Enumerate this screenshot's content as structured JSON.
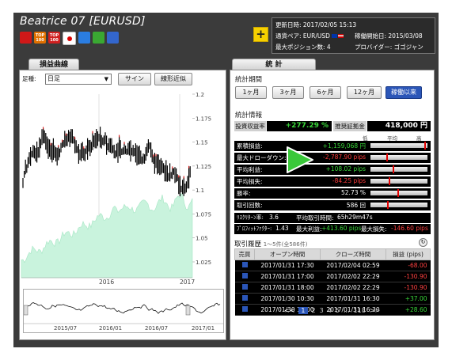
{
  "header": {
    "title": "Beatrice 07 [EURUSD]",
    "icons": [
      {
        "name": "ranking-icon",
        "text": "",
        "color": "#d01818"
      },
      {
        "name": "top100-icon",
        "text": "TOP 100",
        "color": "#e07000"
      },
      {
        "name": "top100-alt-icon",
        "text": "TOP 100",
        "color": "#d02020"
      },
      {
        "name": "japan-flag-icon",
        "text": "",
        "color": "#ffffff"
      },
      {
        "name": "chart-badge-icon",
        "text": "",
        "color": "#2a7de1"
      },
      {
        "name": "trophy-icon",
        "text": "",
        "color": "#3aa832"
      },
      {
        "name": "globe-icon",
        "text": "",
        "color": "#3366cc"
      }
    ],
    "add_button": "+"
  },
  "info": {
    "updated": "更新日時: 2017/02/05 15:13",
    "pair": "通貨ペア: EUR/USD",
    "start": "稼働開始日: 2015/03/08",
    "max_positions": "最大ポジション数: 4",
    "provider": "プロバイダー: ゴゴジャン"
  },
  "left": {
    "tab": "損益曲線",
    "foot_label": "足種:",
    "foot_value": "日足",
    "sign_button": "サイン",
    "linear_button": "線形近似",
    "yticks": [
      "1.2",
      "1.175",
      "1.15",
      "1.125",
      "1.1",
      "1.075",
      "1.05",
      "1.025"
    ],
    "xticks": [
      "2016",
      "2017"
    ],
    "nav_xticks": [
      "2015/07",
      "2016/01",
      "2016/07",
      "2017/01"
    ]
  },
  "right": {
    "tab": "統 計",
    "period_title": "統計期間",
    "periods": [
      "1ヶ月",
      "3ヶ月",
      "6ヶ月",
      "12ヶ月",
      "稼働以来"
    ],
    "stats_title": "統計情報",
    "roi_label": "投資収益率",
    "roi_value": "+277.29 %",
    "margin_label": "推奨証拠金",
    "margin_value": "418,000 円",
    "scale": [
      "低",
      "平均",
      "高"
    ],
    "rows": [
      {
        "label": "累積損益:",
        "value": "+1,159,068 円",
        "color": "#39d639",
        "gauge": 0.97
      },
      {
        "label": "最大ドローダウン:",
        "value": "-2,787.90 pips",
        "color": "#ff3b3b",
        "gauge": 0.28
      },
      {
        "label": "平均利益:",
        "value": "+108.02 pips",
        "color": "#39d639",
        "gauge": 0.4
      },
      {
        "label": "平均損失:",
        "value": "-84.25 pips",
        "color": "#ff3b3b",
        "gauge": 0.33
      },
      {
        "label": "勝率:",
        "value": "52.73 %",
        "color": "#ffffff",
        "gauge": 0.48
      },
      {
        "label": "取引回数:",
        "value": "586 回",
        "color": "#ffffff",
        "gauge": 0.3
      }
    ],
    "extra1": {
      "risk_label": "ﾘｽｸﾘﾀｰﾝ率:",
      "risk_value": "3.6",
      "hold_label": "平均取引時間:",
      "hold_value": "65h29m47s"
    },
    "extra2": {
      "pf_label": "ﾌﾟﾛﾌｨｯﾄﾌｧｸﾀｰ:",
      "pf_value": "1.43",
      "maxprofit_label": "最大利益:",
      "maxprofit_value": "+413.60 pips",
      "maxloss_label": "最大損失:",
      "maxloss_value": "-146.60 pips"
    },
    "history_title": "取引履歴",
    "history_range": "1～5件(全586件)",
    "history_headers": [
      "売買",
      "オープン時間",
      "クローズ時間",
      "損益 (pips)"
    ],
    "history": [
      {
        "open": "2017/01/31 17:30",
        "close": "2017/02/04 02:59",
        "pips": "-68.00",
        "color": "#ff4040"
      },
      {
        "open": "2017/01/31 17:00",
        "close": "2017/02/02 22:29",
        "pips": "-130.90",
        "color": "#ff4040"
      },
      {
        "open": "2017/01/31 18:00",
        "close": "2017/02/02 22:29",
        "pips": "-130.90",
        "color": "#ff4040"
      },
      {
        "open": "2017/01/30 10:30",
        "close": "2017/01/31 16:30",
        "pips": "+37.00",
        "color": "#39d639"
      },
      {
        "open": "2017/01/30 10:00",
        "close": "2017/01/31 16:30",
        "pips": "+28.60",
        "color": "#39d639"
      }
    ],
    "pager": {
      "prev": "<<",
      "current": "1",
      "pages": [
        "2",
        "3",
        "4",
        "5"
      ],
      "ellipsis": "...",
      "last": "118",
      "next": ">>"
    }
  }
}
